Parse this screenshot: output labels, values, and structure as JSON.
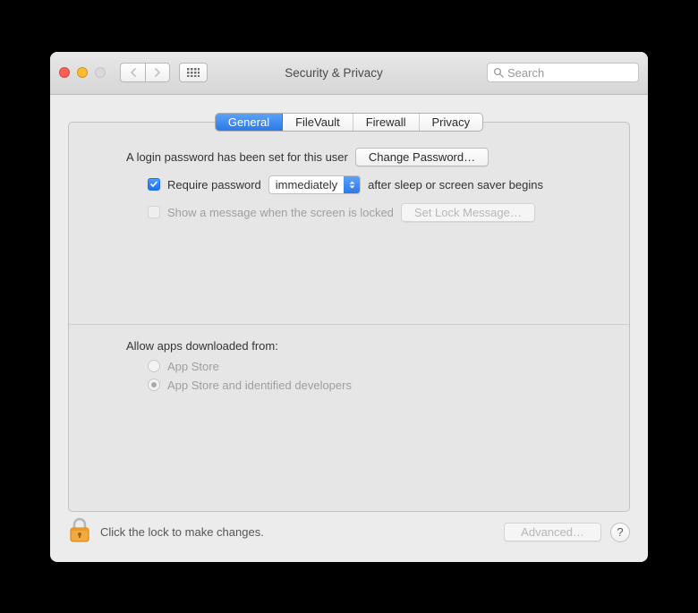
{
  "window": {
    "title": "Security & Privacy"
  },
  "search": {
    "placeholder": "Search"
  },
  "tabs": [
    {
      "label": "General"
    },
    {
      "label": "FileVault"
    },
    {
      "label": "Firewall"
    },
    {
      "label": "Privacy"
    }
  ],
  "general": {
    "login_password_text": "A login password has been set for this user",
    "change_password_button": "Change Password…",
    "require_password_label": "Require password",
    "require_password_delay": "immediately",
    "after_sleep_text": "after sleep or screen saver begins",
    "show_message_label": "Show a message when the screen is locked",
    "set_lock_message_button": "Set Lock Message…",
    "allow_apps_label": "Allow apps downloaded from:",
    "radio_appstore": "App Store",
    "radio_identified": "App Store and identified developers"
  },
  "footer": {
    "lock_hint": "Click the lock to make changes.",
    "advanced_button": "Advanced…",
    "help": "?"
  }
}
